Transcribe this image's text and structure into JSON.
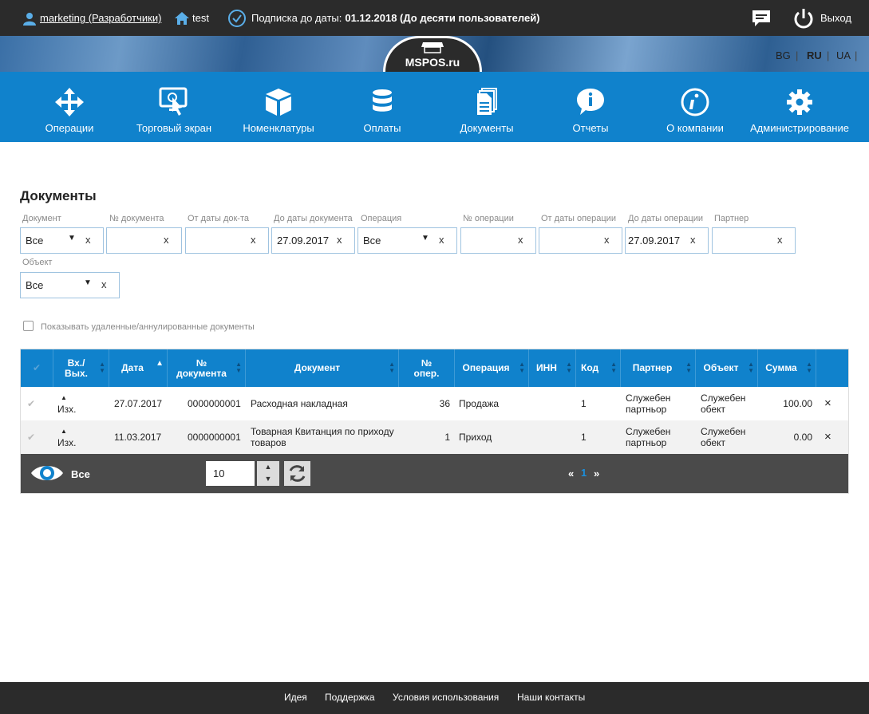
{
  "topbar": {
    "user": "marketing (Разработчики)",
    "store": "test",
    "subscription_label": "Подписка до даты:",
    "subscription_value": "01.12.2018 (До десяти пользователей)",
    "logout": "Выход"
  },
  "logo": {
    "text": "MSPOS.ru"
  },
  "languages": [
    "BG",
    "RU",
    "UA"
  ],
  "nav": [
    {
      "label": "Операции",
      "icon": "arrows-move-icon"
    },
    {
      "label": "Торговый экран",
      "icon": "touch-screen-icon"
    },
    {
      "label": "Номенклатуры",
      "icon": "box-icon"
    },
    {
      "label": "Оплаты",
      "icon": "database-icon"
    },
    {
      "label": "Документы",
      "icon": "documents-icon"
    },
    {
      "label": "Отчеты",
      "icon": "info-bubble-icon"
    },
    {
      "label": "О компании",
      "icon": "info-circle-icon"
    },
    {
      "label": "Администрирование",
      "icon": "gear-icon"
    }
  ],
  "page_title": "Документы",
  "filters": {
    "document_type": {
      "label": "Документ",
      "value": "Все"
    },
    "doc_number": {
      "label": "№ документа",
      "value": ""
    },
    "doc_date_from": {
      "label": "От даты док-та",
      "value": ""
    },
    "doc_date_to": {
      "label": "До даты документа",
      "value": "27.09.2017"
    },
    "operation": {
      "label": "Операция",
      "value": "Все"
    },
    "op_number": {
      "label": "№ операции",
      "value": ""
    },
    "op_date_from": {
      "label": "От даты операции",
      "value": ""
    },
    "op_date_to": {
      "label": "До даты операции",
      "value": "27.09.2017"
    },
    "partner": {
      "label": "Партнер",
      "value": ""
    },
    "object": {
      "label": "Объект",
      "value": "Все"
    },
    "clear_symbol": "x"
  },
  "show_deleted": {
    "label": "Показывать удаленные/аннулированные документы",
    "checked": false
  },
  "table": {
    "headers": {
      "direction": "Вх./ Вых.",
      "date": "Дата",
      "doc_number": "№ документа",
      "document": "Документ",
      "op_number": "№ опер.",
      "operation": "Операция",
      "inn": "ИНН",
      "code": "Код",
      "partner": "Партнер",
      "object": "Объект",
      "sum": "Сумма"
    },
    "rows": [
      {
        "direction": "Изх.",
        "date": "27.07.2017",
        "doc_number": "0000000001",
        "document": "Расходная накладная",
        "op_number": "36",
        "operation": "Продажа",
        "inn": "",
        "code": "1",
        "partner": "Служебен партньор",
        "object": "Служебен обект",
        "sum": "100.00",
        "delete": "×"
      },
      {
        "direction": "Изх.",
        "date": "11.03.2017",
        "doc_number": "0000000001",
        "document": "Товарная Квитанция по приходу товаров",
        "op_number": "1",
        "operation": "Приход",
        "inn": "",
        "code": "1",
        "partner": "Служебен партньор",
        "object": "Служебен обект",
        "sum": "0.00",
        "delete": "×"
      }
    ]
  },
  "pager": {
    "visibility_label": "Все",
    "page_size": "10",
    "prev": "«",
    "current_page": "1",
    "next": "»"
  },
  "footer": {
    "links": [
      "Идея",
      "Поддержка",
      "Условия использования",
      "Наши контакты"
    ]
  },
  "colors": {
    "accent": "#1082cc",
    "dark": "#2b2b2b"
  }
}
